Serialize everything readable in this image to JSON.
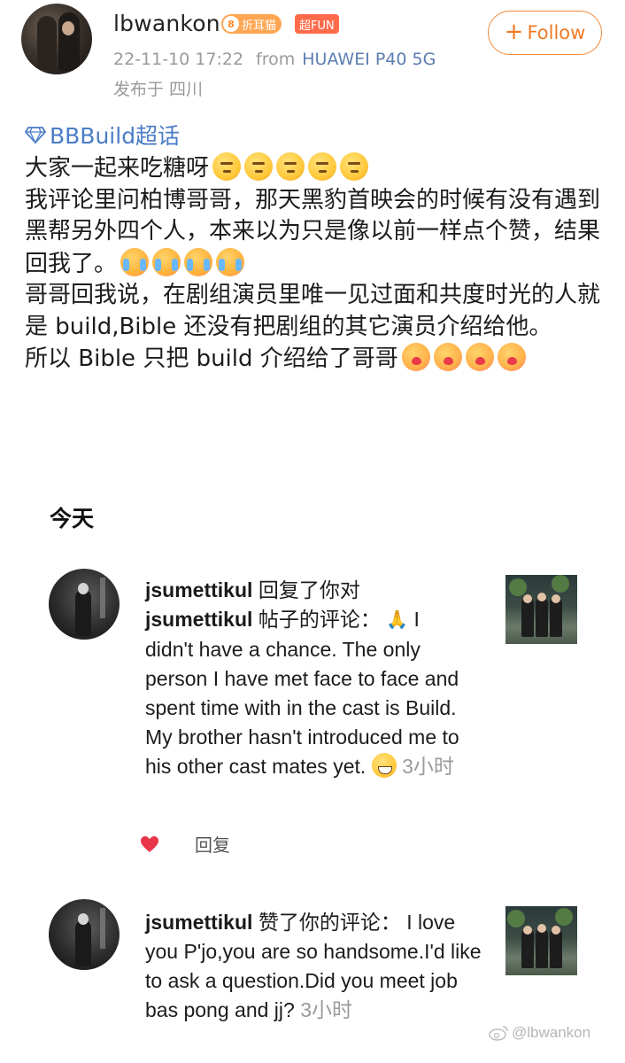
{
  "post": {
    "author": "lbwankon",
    "level": "8",
    "badge_level_text": "折耳猫",
    "badge_fun": "超FUN",
    "follow_label": "Follow",
    "date": "22-11-10 17:22",
    "from_label": "from",
    "device": "HUAWEI P40 5G",
    "location": "发布于 四川",
    "topic": "BBBuild超话",
    "lines": [
      "大家一起来吃糖呀",
      "我评论里问柏博哥哥，那天黑豹首映会的时候有没有遇到黑帮另外四个人，本来以为只是像以前一样点个赞，结果回我了。",
      "哥哥回我说，在剧组演员里唯一见过面和共度时光的人就是 build,Bible 还没有把剧组的其它演员介绍给他。",
      "所以 Bible 只把 build 介绍给了哥哥"
    ]
  },
  "section": {
    "title": "今天"
  },
  "notifications": [
    {
      "user": "jsumettikul",
      "action": "回复了你对",
      "user2": "jsumettikul",
      "action2": "帖子的评论：",
      "body": "I didn't have a chance. The only person I have met face to face and spent time with in the cast is Build. My brother hasn't introduced me to his other cast mates yet.",
      "time": "3小时",
      "reply_label": "回复"
    },
    {
      "user": "jsumettikul",
      "action": "赞了你的评论：",
      "body": "I love you P'jo,you are so handsome.I'd like to ask a question.Did you meet job bas pong and jj?",
      "time": "3小时"
    }
  ],
  "watermark": "@lbwankon",
  "colors": {
    "accent": "#f07a23",
    "link": "#4a7cc7",
    "device": "#5b7db1",
    "muted": "#9a9a9a",
    "like": "#e8354a"
  }
}
